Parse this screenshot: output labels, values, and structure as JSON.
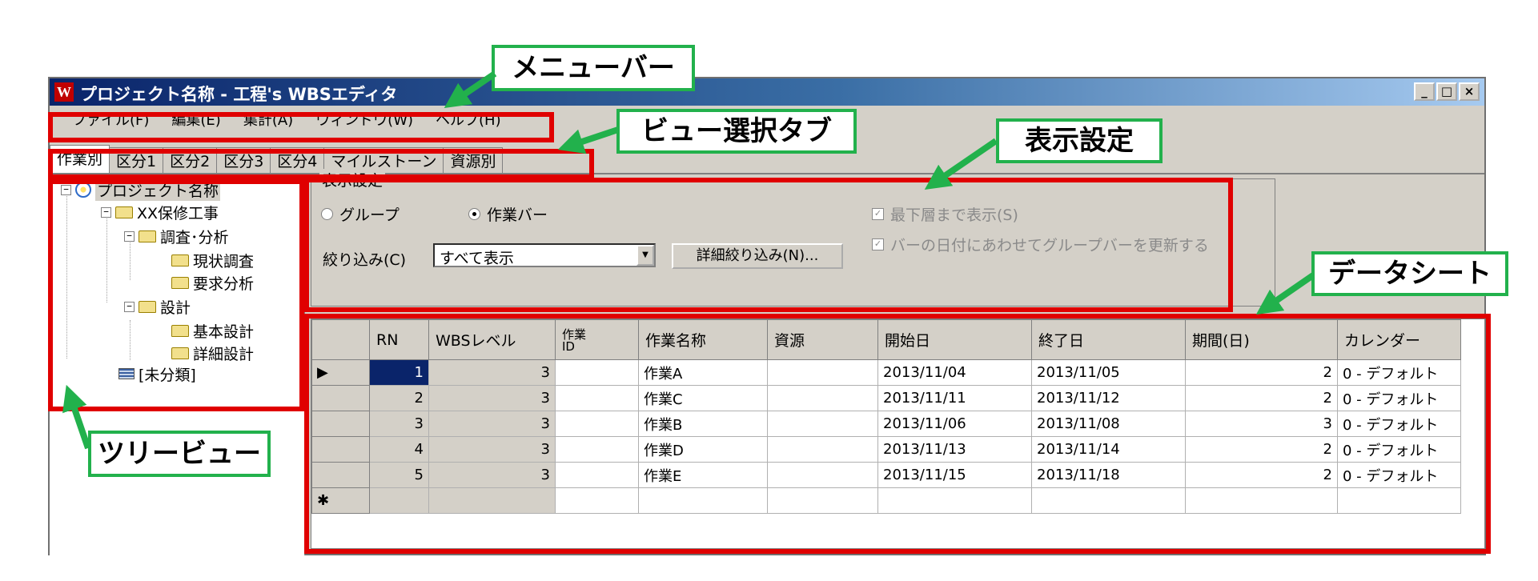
{
  "window": {
    "title": "プロジェクト名称 - 工程's WBSエディタ",
    "icon_letter": "W",
    "controls": {
      "minimize": "_",
      "maximize": "□",
      "close": "×"
    }
  },
  "menubar": [
    "ファイル(F)",
    "編集(E)",
    "集計(A)",
    "ウィンドウ(W)",
    "ヘルプ(H)"
  ],
  "tabs": [
    "作業別",
    "区分1",
    "区分2",
    "区分3",
    "区分4",
    "マイルストーン",
    "資源別"
  ],
  "tree": {
    "root": "プロジェクト名称",
    "items": [
      "XX保修工事",
      "調査･分析",
      "現状調査",
      "要求分析",
      "設計",
      "基本設計",
      "詳細設計",
      "[未分類]"
    ]
  },
  "settings": {
    "title": "表示設定",
    "radio_group": "グループ",
    "radio_bar": "作業バー",
    "filter_label": "絞り込み(C)",
    "filter_value": "すべて表示",
    "detail_button": "詳細絞り込み(N)...",
    "check_lowest": "最下層まで表示(S)",
    "check_update": "バーの日付にあわせてグループバーを更新する"
  },
  "grid": {
    "headers": [
      "RN",
      "WBSレベル",
      "作業ID",
      "作業名称",
      "資源",
      "開始日",
      "終了日",
      "期間(日)",
      "カレンダー"
    ],
    "header_id_line1": "作業",
    "header_id_line2": "ID",
    "rows": [
      {
        "rn": "1",
        "level": "3",
        "id": "",
        "name": "作業A",
        "resource": "",
        "start": "2013/11/04",
        "end": "2013/11/05",
        "days": "2",
        "calendar": "0 - デフォルト"
      },
      {
        "rn": "2",
        "level": "3",
        "id": "",
        "name": "作業C",
        "resource": "",
        "start": "2013/11/11",
        "end": "2013/11/12",
        "days": "2",
        "calendar": "0 - デフォルト"
      },
      {
        "rn": "3",
        "level": "3",
        "id": "",
        "name": "作業B",
        "resource": "",
        "start": "2013/11/06",
        "end": "2013/11/08",
        "days": "3",
        "calendar": "0 - デフォルト"
      },
      {
        "rn": "4",
        "level": "3",
        "id": "",
        "name": "作業D",
        "resource": "",
        "start": "2013/11/13",
        "end": "2013/11/14",
        "days": "2",
        "calendar": "0 - デフォルト"
      },
      {
        "rn": "5",
        "level": "3",
        "id": "",
        "name": "作業E",
        "resource": "",
        "start": "2013/11/15",
        "end": "2013/11/18",
        "days": "2",
        "calendar": "0 - デフォルト"
      }
    ],
    "current_row_marker": "▶",
    "new_row_marker": "✱"
  },
  "annotations": {
    "menubar": "メニューバー",
    "view_tabs": "ビュー選択タブ",
    "display_settings": "表示設定",
    "datasheet": "データシート",
    "treeview": "ツリービュー"
  },
  "colors": {
    "annotation_box": "#e00000",
    "callout_border": "#22b14c",
    "window_face": "#d4d0c8",
    "title_start": "#0a246a"
  }
}
